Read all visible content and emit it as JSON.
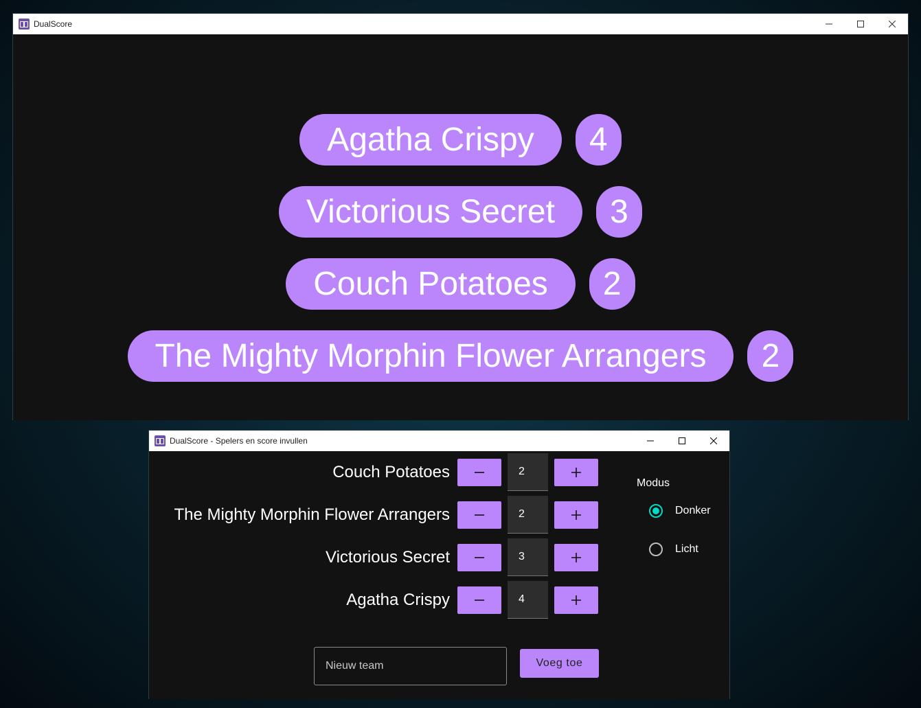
{
  "display_window": {
    "title": "DualScore",
    "scoreboard": [
      {
        "team": "Agatha Crispy",
        "score": "4"
      },
      {
        "team": "Victorious Secret",
        "score": "3"
      },
      {
        "team": "Couch Potatoes",
        "score": "2"
      },
      {
        "team": "The Mighty Morphin Flower Arrangers",
        "score": "2"
      }
    ]
  },
  "control_window": {
    "title": "DualScore - Spelers en score invullen",
    "teams": [
      {
        "name": "Couch Potatoes",
        "score": "2"
      },
      {
        "name": "The Mighty Morphin Flower Arrangers",
        "score": "2"
      },
      {
        "name": "Victorious Secret",
        "score": "3"
      },
      {
        "name": "Agatha Crispy",
        "score": "4"
      }
    ],
    "new_team_placeholder": "Nieuw team",
    "add_button_label": "Voeg toe",
    "mode": {
      "label": "Modus",
      "options": [
        {
          "label": "Donker",
          "checked": true
        },
        {
          "label": "Licht",
          "checked": false
        }
      ]
    }
  },
  "colors": {
    "accent": "#bb86fc",
    "radio_selected": "#03dac5",
    "background": "#121212"
  },
  "icons": {
    "minus": "minus-icon",
    "plus": "plus-icon",
    "minimize": "minimize-icon",
    "maximize": "maximize-icon",
    "close": "close-icon"
  }
}
